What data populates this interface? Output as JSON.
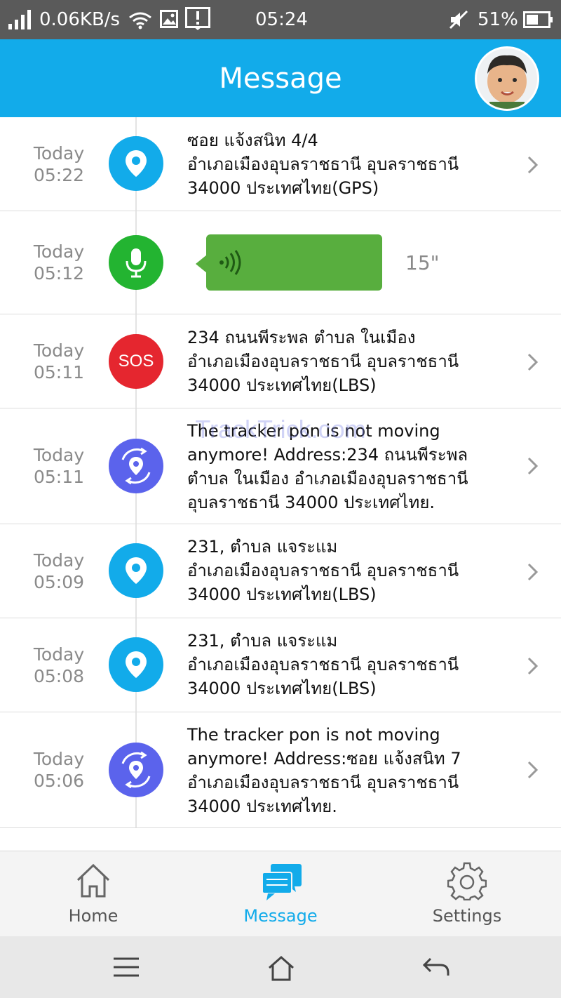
{
  "status_bar": {
    "network_speed": "0.06KB/s",
    "time": "05:24",
    "battery": "51%",
    "icons": [
      "signal-icon",
      "wifi-icon",
      "image-icon",
      "alert-icon",
      "mute-icon",
      "battery-icon"
    ]
  },
  "header": {
    "title": "Message",
    "avatar": "avatar"
  },
  "watermark": "TrackTrick.com",
  "messages": [
    {
      "day": "Today",
      "time": "05:22",
      "icon": "location-pin-icon",
      "color": "#12abea",
      "text": "ซอย แจ้งสนิท 4/4\nอำเภอเมืองอุบลราชธานี อุบลราชธานี\n34000 ประเทศไทย(GPS)"
    },
    {
      "day": "Today",
      "time": "05:12",
      "icon": "microphone-icon",
      "color": "#23b431",
      "duration": "15\""
    },
    {
      "day": "Today",
      "time": "05:11",
      "icon": "sos-icon",
      "color": "#e5262f",
      "icon_text": "SOS",
      "text": "234 ถนนพีระพล ตำบล ในเมือง\nอำเภอเมืองอุบลราชธานี อุบลราชธานี\n34000 ประเทศไทย(LBS)"
    },
    {
      "day": "Today",
      "time": "05:11",
      "icon": "not-moving-icon",
      "color": "#5b63ec",
      "text": "The tracker pon is not moving\nanymore! Address:234 ถนนพีระพล\nตำบล ในเมือง อำเภอเมืองอุบลราชธานี\nอุบลราชธานี 34000 ประเทศไทย."
    },
    {
      "day": "Today",
      "time": "05:09",
      "icon": "location-pin-icon",
      "color": "#12abea",
      "text": "231, ตำบล แจระแม\nอำเภอเมืองอุบลราชธานี อุบลราชธานี\n34000 ประเทศไทย(LBS)"
    },
    {
      "day": "Today",
      "time": "05:08",
      "icon": "location-pin-icon",
      "color": "#12abea",
      "text": "231, ตำบล แจระแม\nอำเภอเมืองอุบลราชธานี อุบลราชธานี\n34000 ประเทศไทย(LBS)"
    },
    {
      "day": "Today",
      "time": "05:06",
      "icon": "not-moving-icon",
      "color": "#5b63ec",
      "text": "The tracker pon is not moving\nanymore! Address:ซอย แจ้งสนิท 7\nอำเภอเมืองอุบลราชธานี อุบลราชธานี\n34000 ประเทศไทย."
    }
  ],
  "bottom_nav": {
    "items": [
      {
        "label": "Home",
        "icon": "home-icon",
        "active": false
      },
      {
        "label": "Message",
        "icon": "chat-icon",
        "active": true
      },
      {
        "label": "Settings",
        "icon": "gear-icon",
        "active": false
      }
    ],
    "active_color": "#12abea"
  },
  "system_nav": [
    "menu-icon",
    "home-icon",
    "back-icon"
  ]
}
